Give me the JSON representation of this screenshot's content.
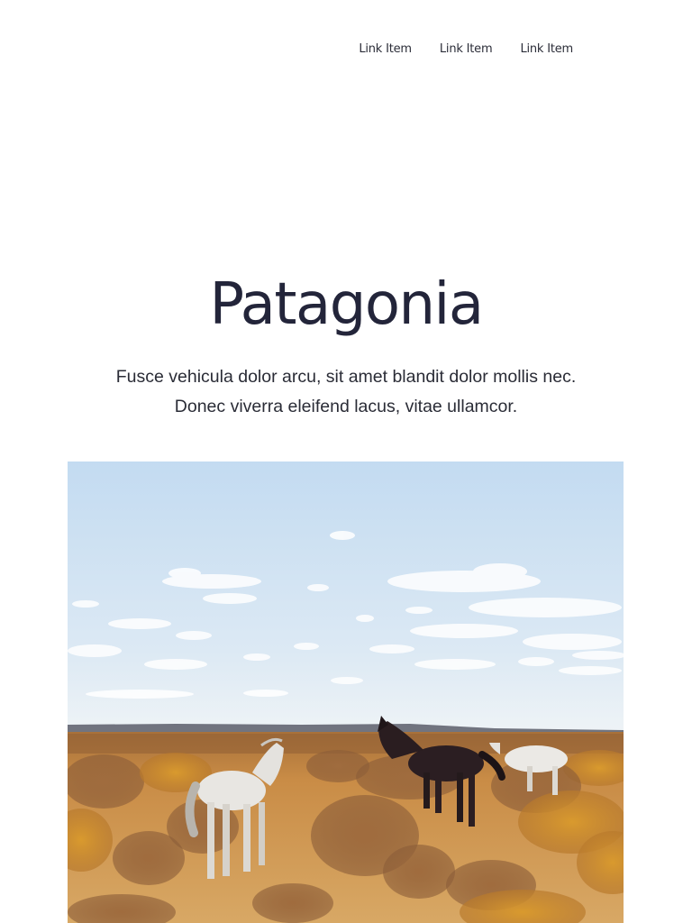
{
  "nav": {
    "links": [
      {
        "label": "Link Item"
      },
      {
        "label": "Link Item"
      },
      {
        "label": "Link Item"
      }
    ]
  },
  "hero": {
    "title": "Patagonia",
    "subtitle_line1": "Fusce vehicula dolor arcu, sit amet blandit dolor mollis nec.",
    "subtitle_line2": "Donec viverra eleifend lacus, vitae ullamcor."
  },
  "colors": {
    "title": "#23253a",
    "text": "#2a2c36",
    "sky_top": "#c6ddf1",
    "sky_bottom": "#e9f1f7",
    "grass": "#c98a3a"
  }
}
